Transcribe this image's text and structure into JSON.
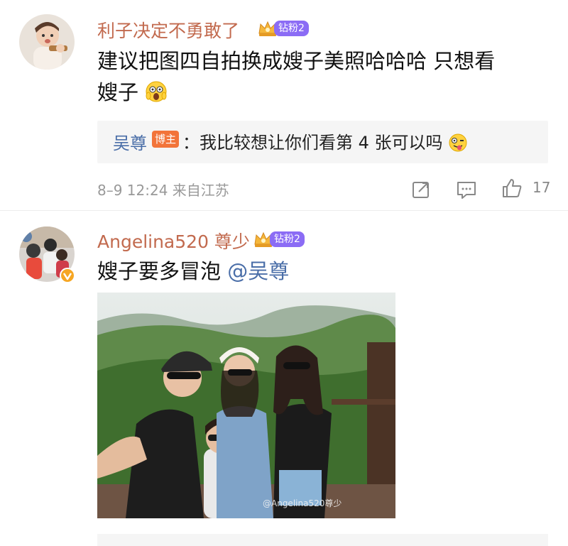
{
  "comments": [
    {
      "username": "利子决定不勇敢了",
      "badge_label": "钻粉2",
      "text": "建议把图四自拍换成嫂子美照哈哈哈 只想看",
      "text_line2": "嫂子",
      "reply": {
        "user": "吴尊",
        "tag": "博主",
        "text": "：我比较想让你们看第 4 张可以吗"
      },
      "meta": "8–9 12:24  来自江苏",
      "like_count": "17"
    },
    {
      "username": "Angelina520 尊少",
      "badge_label": "钻粉2",
      "text": "嫂子要多冒泡",
      "mention": "@吴尊",
      "watermark": "@Angelina520尊少"
    }
  ],
  "icons": {
    "share": "share-icon",
    "comment": "comment-icon",
    "like": "thumbs-up-icon",
    "crown": "crown-icon",
    "verified": "verified-icon"
  },
  "colors": {
    "username": "#c26a4e",
    "mention": "#4a6ea8",
    "badge": "#8b6cf5",
    "blogger_tag": "#f2743a"
  }
}
